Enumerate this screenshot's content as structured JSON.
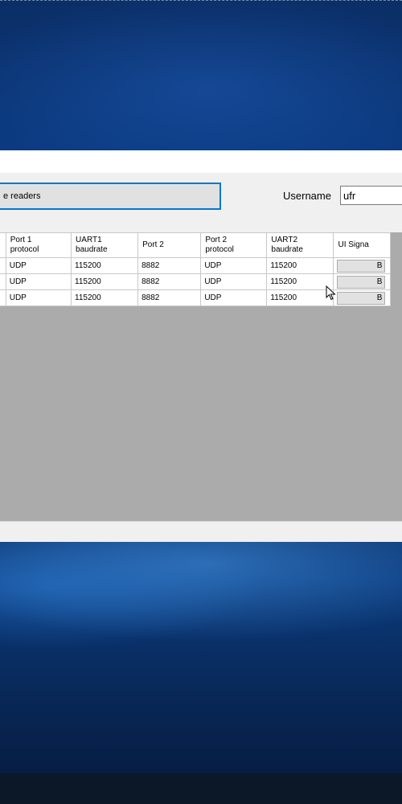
{
  "form": {
    "readers_button_label": "e readers",
    "username_label": "Username",
    "username_value": "ufr"
  },
  "grid": {
    "columns": [
      {
        "line1": "Port 1",
        "line2": "protocol"
      },
      {
        "line1": "UART1",
        "line2": "baudrate"
      },
      {
        "line1": "Port 2",
        "line2": ""
      },
      {
        "line1": "Port 2",
        "line2": "protocol"
      },
      {
        "line1": "UART2",
        "line2": "baudrate"
      },
      {
        "line1": "UI Signa",
        "line2": ""
      }
    ],
    "rows": [
      {
        "port1_protocol": "UDP",
        "uart1_baudrate": "115200",
        "port2": "8882",
        "port2_protocol": "UDP",
        "uart2_baudrate": "115200",
        "ui_signal_button": "B"
      },
      {
        "port1_protocol": "UDP",
        "uart1_baudrate": "115200",
        "port2": "8882",
        "port2_protocol": "UDP",
        "uart2_baudrate": "115200",
        "ui_signal_button": "B"
      },
      {
        "port1_protocol": "UDP",
        "uart1_baudrate": "115200",
        "port2": "8882",
        "port2_protocol": "UDP",
        "uart2_baudrate": "115200",
        "ui_signal_button": "B"
      }
    ]
  },
  "colors": {
    "focus_border": "#0078d7",
    "grid_background": "#ababab",
    "window_background": "#f0f0f0"
  },
  "icons": [
    "mouse-cursor-icon"
  ]
}
